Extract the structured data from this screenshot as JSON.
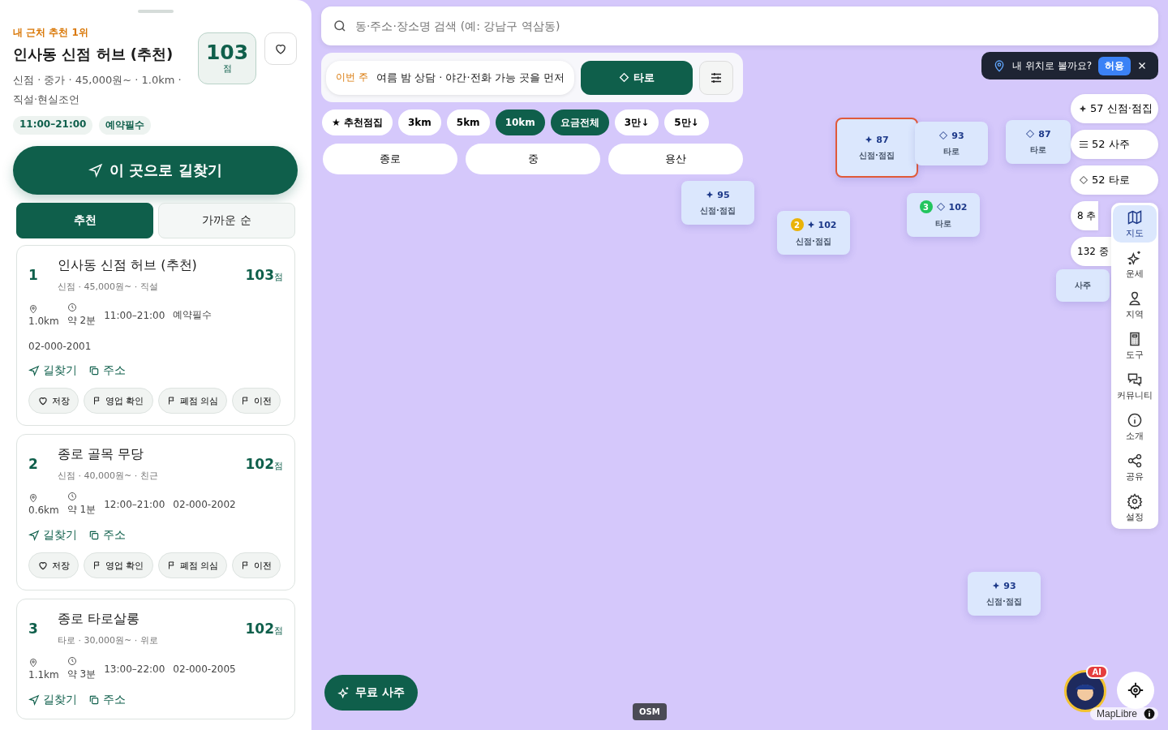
{
  "panel": {
    "eyebrow": "내 근처 추천 1위",
    "title": "인사동 신점 허브 (추천)",
    "meta": "신점 · 중가 · 45,000원~ · 1.0km · 직설·현실조언",
    "score": "103",
    "score_unit": "점",
    "favorite": false,
    "tags": [
      "11:00–21:00",
      "예약필수"
    ],
    "route_button": "이 곳으로 길찾기"
  },
  "sort_tabs": [
    {
      "label": "추천",
      "selected": true
    },
    {
      "label": "가까운 순",
      "selected": false
    }
  ],
  "places": [
    {
      "rank": "1",
      "name": "인사동 신점 허브 (추천)",
      "meta": "신점 · 45,000원~ · 직설",
      "score": "103",
      "score_unit": "점",
      "distance": "1.0km",
      "walk": "약 2분",
      "details": [
        "11:00–21:00",
        "예약필수"
      ],
      "phone": "02-000-2001",
      "links": [
        {
          "kind": "route",
          "label": "길찾기"
        },
        {
          "kind": "copy",
          "label": "주소"
        }
      ],
      "actions": [
        {
          "kind": "save",
          "label": "저장"
        },
        {
          "kind": "flag",
          "label": "영업 확인"
        },
        {
          "kind": "flag",
          "label": "폐점 의심"
        },
        {
          "kind": "flag",
          "label": "이전"
        }
      ]
    },
    {
      "rank": "2",
      "name": "종로 골목 무당",
      "meta": "신점 · 40,000원~ · 친근",
      "score": "102",
      "score_unit": "점",
      "distance": "0.6km",
      "walk": "약 1분",
      "details": [
        "12:00–21:00",
        "02-000-2002"
      ],
      "links": [
        {
          "kind": "route",
          "label": "길찾기"
        },
        {
          "kind": "copy",
          "label": "주소"
        }
      ],
      "actions": [
        {
          "kind": "save",
          "label": "저장"
        },
        {
          "kind": "flag",
          "label": "영업 확인"
        },
        {
          "kind": "flag",
          "label": "폐점 의심"
        },
        {
          "kind": "flag",
          "label": "이전"
        }
      ]
    },
    {
      "rank": "3",
      "name": "종로 타로살롱",
      "meta": "타로 · 30,000원~ · 위로",
      "score": "102",
      "score_unit": "점",
      "distance": "1.1km",
      "walk": "약 3분",
      "details": [
        "13:00–22:00",
        "02-000-2005"
      ],
      "links": [
        {
          "kind": "route",
          "label": "길찾기"
        },
        {
          "kind": "copy",
          "label": "주소"
        }
      ]
    }
  ],
  "search": {
    "placeholder": "동·주소·장소명 검색 (예: 강남구 역삼동)"
  },
  "banner": {
    "tag": "이번 주",
    "text": "여름 밤 상담 · 야간·전화 가능 곳을 먼저"
  },
  "category_button": {
    "label": "타로"
  },
  "filter_chips": [
    {
      "label": "★ 추천점집",
      "selected": false
    },
    {
      "label": "3km",
      "selected": false
    },
    {
      "label": "5km",
      "selected": false
    },
    {
      "label": "10km",
      "selected": true
    },
    {
      "label": "요금전체",
      "selected": true
    },
    {
      "label": "3만↓",
      "selected": false
    },
    {
      "label": "5만↓",
      "selected": false
    }
  ],
  "regions": [
    "종로",
    "중",
    "용산"
  ],
  "location_prompt": {
    "text": "내 위치로 볼까요?",
    "allow": "허용"
  },
  "markers": [
    {
      "kind": "sparkle",
      "score": "87",
      "category": "신점·점집",
      "selected": true
    },
    {
      "kind": "diamond",
      "score": "93",
      "category": "타로",
      "selected": false
    },
    {
      "kind": "diamond",
      "score": "87",
      "category": "타로",
      "selected": false
    },
    {
      "kind": "sparkle",
      "score": "95",
      "category": "신점·점집",
      "selected": false
    },
    {
      "kind": "sparkle",
      "score": "102",
      "category": "신점·점집",
      "selected": false,
      "rank": "2",
      "color": "#eab308"
    },
    {
      "kind": "diamond",
      "score": "102",
      "category": "타로",
      "selected": false,
      "rank": "3",
      "color": "#22c55e"
    },
    {
      "kind": "hidden",
      "category": "사주",
      "selected": false
    },
    {
      "kind": "sparkle",
      "score": "93",
      "category": "신점·점집",
      "selected": false
    }
  ],
  "category_pills": [
    {
      "kind": "sparkle",
      "text": "57 신점·점집"
    },
    {
      "kind": "lines",
      "text": "52 사주"
    },
    {
      "kind": "diamond",
      "text": "52 타로"
    },
    {
      "kind": "count",
      "text": "8 추"
    },
    {
      "kind": "count",
      "text": "132 중"
    }
  ],
  "nav": [
    {
      "kind": "map",
      "label": "지도",
      "selected": true
    },
    {
      "kind": "sparkles",
      "label": "운세",
      "selected": false
    },
    {
      "kind": "pin-person",
      "label": "지역",
      "selected": false
    },
    {
      "kind": "calculator",
      "label": "도구",
      "selected": false
    },
    {
      "kind": "chat",
      "label": "커뮤니티",
      "selected": false
    },
    {
      "kind": "info",
      "label": "소개",
      "selected": false
    },
    {
      "kind": "share",
      "label": "공유",
      "selected": false
    },
    {
      "kind": "gear",
      "label": "설정",
      "selected": false
    }
  ],
  "fortune_button": "무료 사주",
  "osm": "OSM",
  "ai_badge": "AI",
  "attribution": "MapLibre"
}
